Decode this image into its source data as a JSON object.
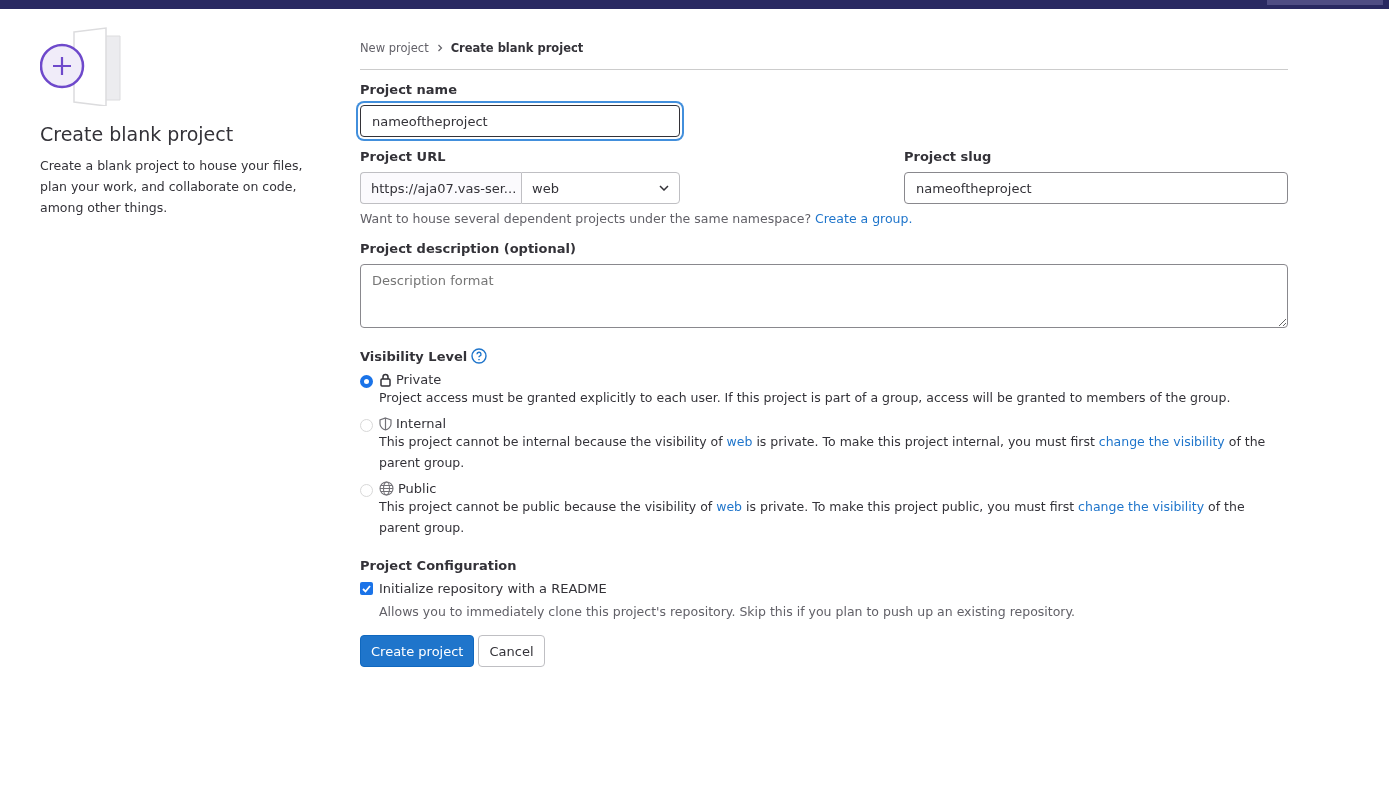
{
  "sidebar": {
    "title": "Create blank project",
    "description": "Create a blank project to house your files, plan your work, and collaborate on code, among other things."
  },
  "breadcrumb": [
    {
      "label": "New project",
      "current": false
    },
    {
      "label": "Create blank project",
      "current": true
    }
  ],
  "project_name": {
    "label": "Project name",
    "value": "nameoftheproject",
    "focused": true
  },
  "project_url": {
    "label": "Project URL",
    "prefix": "https://aja07.vas-ser...",
    "namespace": "web"
  },
  "project_slug": {
    "label": "Project slug",
    "value": "nameoftheproject"
  },
  "namespace_help": [
    {
      "kind": "text",
      "text": "Want to house several dependent projects under the same namespace? "
    },
    {
      "kind": "link",
      "text": "Create a group."
    }
  ],
  "description": {
    "label": "Project description (optional)",
    "placeholder": "Description format"
  },
  "visibility": {
    "label": "Visibility Level",
    "options": [
      {
        "kind": "lock",
        "label": "Private",
        "selected": true,
        "disabled": false,
        "help": [
          {
            "kind": "text",
            "text": "Project access must be granted explicitly to each user. If this project is part of a group, access will be granted to members of the group."
          }
        ]
      },
      {
        "kind": "shield",
        "label": "Internal",
        "selected": false,
        "disabled": true,
        "help": [
          {
            "kind": "text",
            "text": "This project cannot be internal because the visibility of "
          },
          {
            "kind": "link",
            "text": "web"
          },
          {
            "kind": "text",
            "text": " is private. To make this project internal, you must first "
          },
          {
            "kind": "link",
            "text": "change the visibility"
          },
          {
            "kind": "text",
            "text": " of the parent group."
          }
        ]
      },
      {
        "kind": "globe",
        "label": "Public",
        "selected": false,
        "disabled": true,
        "help": [
          {
            "kind": "text",
            "text": "This project cannot be public because the visibility of "
          },
          {
            "kind": "link",
            "text": "web"
          },
          {
            "kind": "text",
            "text": " is private. To make this project public, you must first "
          },
          {
            "kind": "link",
            "text": "change the visibility"
          },
          {
            "kind": "text",
            "text": " of the parent group."
          }
        ]
      }
    ]
  },
  "configuration": {
    "label": "Project Configuration",
    "readme": {
      "label": "Initialize repository with a README",
      "checked": true,
      "help": "Allows you to immediately clone this project's repository. Skip this if you plan to push up an existing repository."
    }
  },
  "buttons": [
    {
      "kind": "primary",
      "label": "Create project"
    },
    {
      "kind": "secondary",
      "label": "Cancel"
    }
  ]
}
